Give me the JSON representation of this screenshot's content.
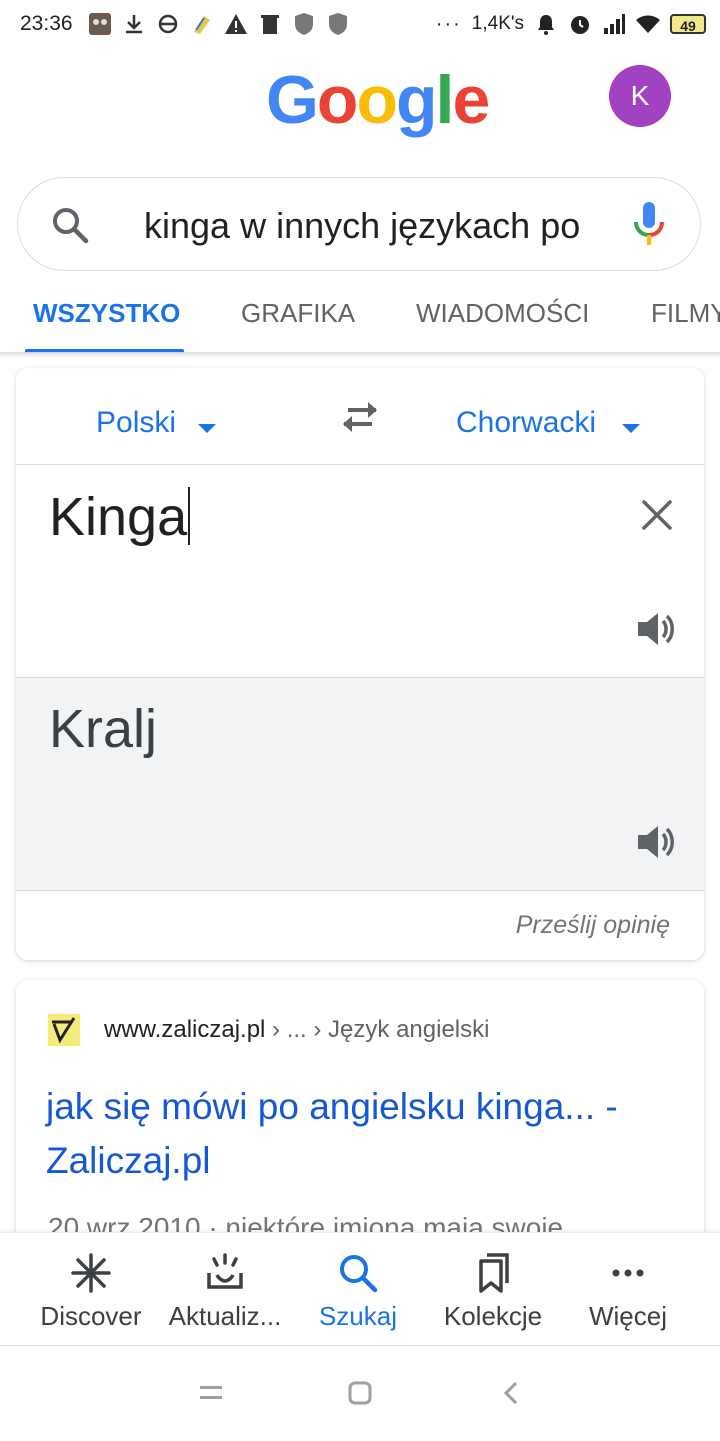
{
  "status_bar": {
    "time": "23:36",
    "net_speed": "1,4K's",
    "battery": "49"
  },
  "header": {
    "logo_letters": [
      "G",
      "o",
      "o",
      "g",
      "l",
      "e"
    ],
    "logo_colors": [
      "#4285f4",
      "#ea4335",
      "#fbbc05",
      "#4285f4",
      "#34a853",
      "#ea4335"
    ],
    "avatar_initial": "K",
    "avatar_color": "#a142c1"
  },
  "search": {
    "query": "kinga w innych językach po"
  },
  "tabs": [
    {
      "label": "WSZYSTKO",
      "active": true
    },
    {
      "label": "GRAFIKA",
      "active": false
    },
    {
      "label": "WIADOMOŚCI",
      "active": false
    },
    {
      "label": "FILMY",
      "active": false
    }
  ],
  "translate": {
    "source_lang": "Polski",
    "target_lang": "Chorwacki",
    "source_text": "Kinga",
    "translated_text": "Kralj",
    "feedback_label": "Prześlij opinię"
  },
  "result": {
    "site": "www.zaliczaj.pl",
    "path": " › ... › Język angielski",
    "title": "jak się mówi po angielsku kinga... - Zaliczaj.pl",
    "snippet": "20 wrz 2010 · niektóre imiona mają swoje"
  },
  "bottom_nav": [
    {
      "label": "Discover",
      "icon": "asterisk-icon",
      "active": false
    },
    {
      "label": "Aktualiz...",
      "icon": "updates-icon",
      "active": false
    },
    {
      "label": "Szukaj",
      "icon": "search-icon",
      "active": true
    },
    {
      "label": "Kolekcje",
      "icon": "bookmarks-icon",
      "active": false
    },
    {
      "label": "Więcej",
      "icon": "more-icon",
      "active": false
    }
  ],
  "colors": {
    "accent": "#1a73e8",
    "link": "#1558d6"
  }
}
